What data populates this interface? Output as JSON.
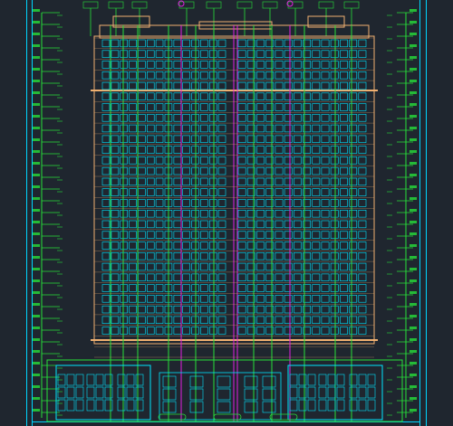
{
  "viewport": {
    "background": "#1f262f"
  },
  "colors": {
    "frame": "#00d6ff",
    "facade": "#f0b070",
    "window": "#00e5ff",
    "grid_green": "#27e03a",
    "grid_magenta": "#e020e0",
    "level_text": "#ffffff",
    "dark_panel": "#2a3340"
  },
  "drawing": {
    "level_count": 30,
    "window_columns_per_block": 14,
    "blocks": 2,
    "podium_floors": 2
  },
  "icons": {
    "axis_bubble": "axis-bubble-icon",
    "level_marker": "level-marker-icon"
  }
}
